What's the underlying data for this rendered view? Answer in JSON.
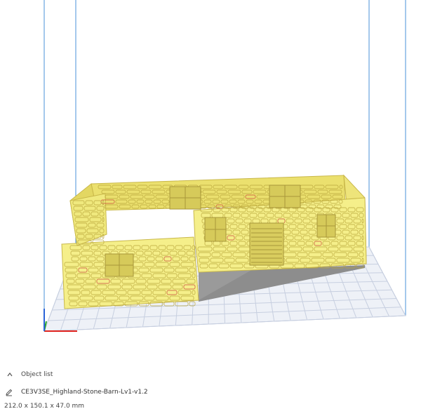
{
  "object_panel": {
    "header_label": "Object list",
    "object_name": "CE3V3SE_Highland-Stone-Barn-Lv1-v1.2",
    "dimensions": "212.0 x 150.1 x 47.0 mm"
  },
  "icons": {
    "collapse": "chevron-up-icon",
    "edit": "pencil-icon"
  },
  "colors": {
    "model": "#f5ef8a",
    "model_shadow": "#d9c85a",
    "build_volume_lines": "#4a90d9",
    "grid_lines": "#c7cfe0",
    "plate": "#eef1f7",
    "axis_x": "#e0231f",
    "axis_y": "#2aa52a",
    "axis_z": "#2a63d8",
    "shadow": "#8d8d8d"
  }
}
